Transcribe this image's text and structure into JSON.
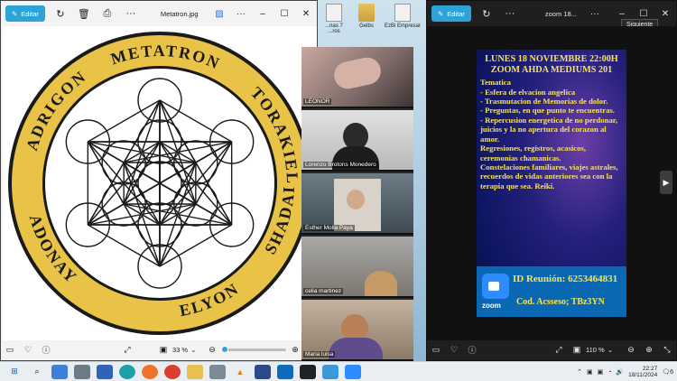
{
  "left_window": {
    "edit_label": "Editar",
    "filename": "Metatron.jpg",
    "zoom_level": "33 %",
    "zoom_fraction": 0.05,
    "ring_words": [
      "METATRON",
      "TORAKIEL",
      "SHADAI",
      "ELYON",
      "ADONAY",
      "ADRIGON"
    ]
  },
  "desktop": {
    "icons": [
      {
        "label": "...nas 7",
        "sub": "...ros"
      },
      {
        "label": "Gelbs",
        "sub": ""
      },
      {
        "label": "EzBi Empresar",
        "sub": ""
      }
    ]
  },
  "participants": [
    {
      "name": "LEONOR"
    },
    {
      "name": "Lorenzo Brotons Monedero"
    },
    {
      "name": "Esther Molla Paya"
    },
    {
      "name": "celia martinez"
    },
    {
      "name": "Maria luisa"
    }
  ],
  "right_window": {
    "edit_label": "Editar",
    "filename": "zoom 18...",
    "tooltip": "Siguiente",
    "zoom_level": "110 %",
    "poster": {
      "title_line1": "LUNES 18 NOVIEMBRE 22:00H",
      "title_line2": "ZOOM AHDA MEDIUMS 201",
      "lines": [
        "Tematica",
        "- Esfera de elvacion angelica",
        "- Trasmutacion de Memorias de dolor.",
        "- Preguntas, en que punto te encuentras.",
        "- Repercusion energetica de no perdonar, juicios y la no apertura del corazon al amor.",
        "Regresiones, registros, acasicos, ceremonias chamanicas.",
        "Constelaciones familiares, viajes astrales, recuerdos de vidas anteriores sea con la terapia que sea. Reiki."
      ],
      "zoom_word": "zoom",
      "meeting_id": "ID Reunión: 6253464831",
      "access_code": "Cod. Acsseso; TBz3YN"
    }
  },
  "taskbar": {
    "time": "22:27",
    "date": "18/11/2024",
    "notification_count": "6"
  },
  "colors": {
    "edit_button": "#2ea3d8",
    "poster_text": "#f6e25a",
    "zoom_blue": "#2d8cff",
    "ring_gold": "#e8c347"
  }
}
